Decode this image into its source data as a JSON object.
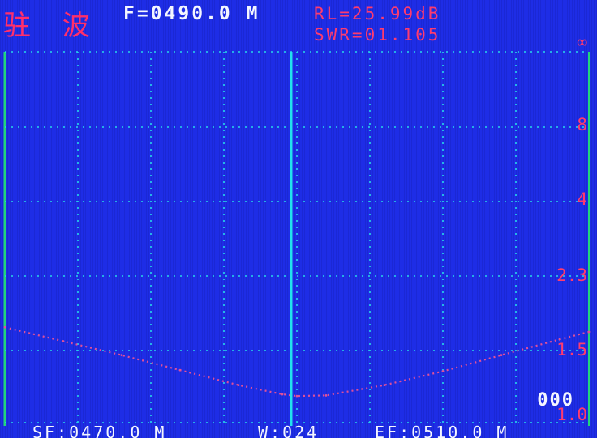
{
  "header": {
    "mode": "驻 波",
    "frequency": "F=0490.0  M",
    "return_loss": "RL=25.99dB",
    "swr": "SWR=01.105"
  },
  "scale_labels": [
    "∞",
    "8",
    "4",
    "2.3",
    "1.5",
    "1.0"
  ],
  "step_value": "000",
  "footer": {
    "start": "SF:0470.0  M",
    "width": "W:024",
    "end": "EF:0510.0  M"
  },
  "chart_data": {
    "type": "line",
    "title": "",
    "xlabel": "",
    "ylabel": "",
    "x_units": "frequency (MHz)",
    "xlim": [
      470,
      510
    ],
    "y_scale_labels": [
      "∞",
      "8",
      "4",
      "2.3",
      "1.5",
      "1.0"
    ],
    "series": [
      {
        "values_x": [
          470,
          474,
          478,
          482,
          486,
          489,
          490,
          492,
          496,
          500,
          504,
          508,
          510
        ],
        "values_y": [
          1.75,
          1.6,
          1.46,
          1.33,
          1.2,
          1.12,
          1.105,
          1.11,
          1.2,
          1.32,
          1.46,
          1.62,
          1.7
        ],
        "color": "#e0509a"
      }
    ],
    "marker_x": 490,
    "colors": {
      "background": "#1e2de6",
      "grid": "#27d8e8",
      "marker": "#22e0ee",
      "trace": "#e0509a",
      "frame": "#22d47a"
    }
  }
}
